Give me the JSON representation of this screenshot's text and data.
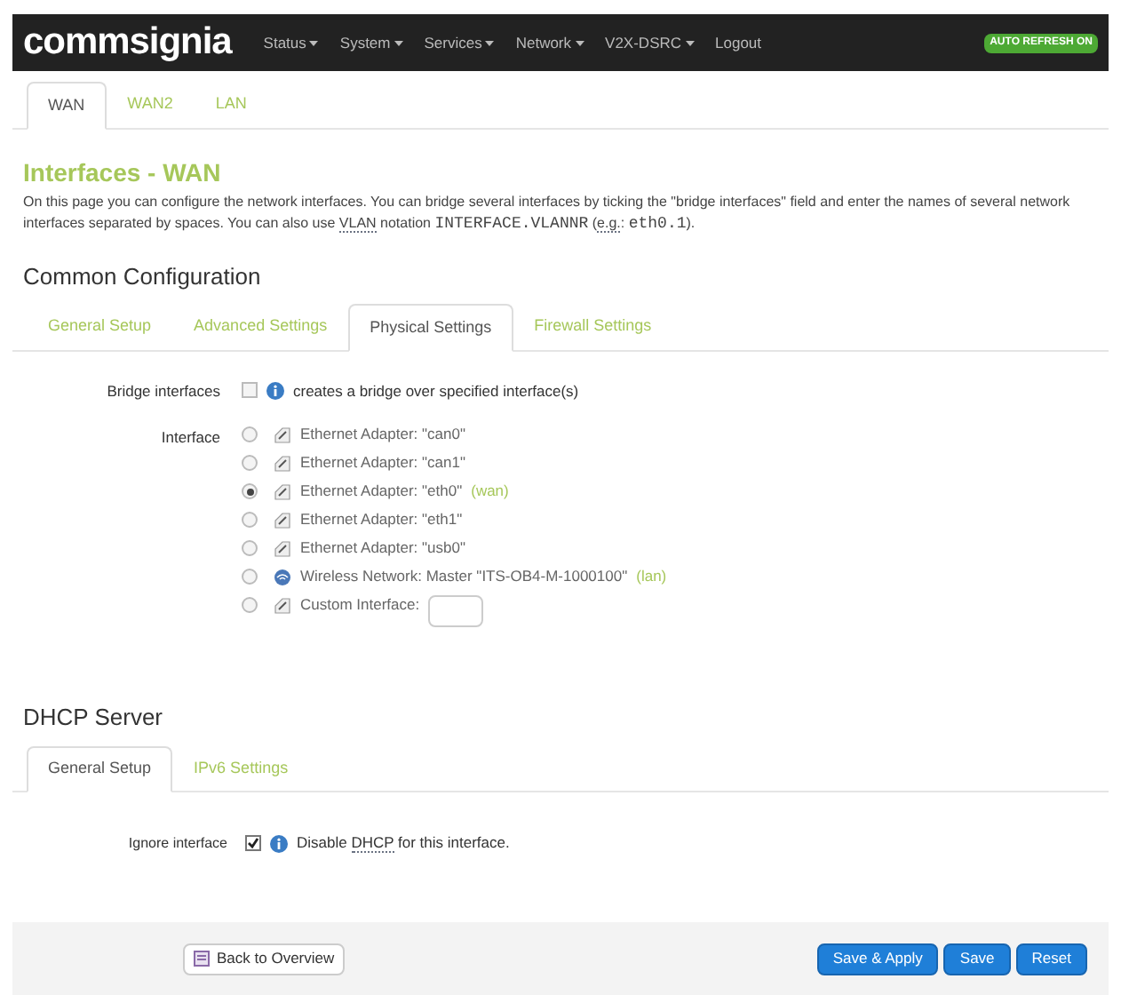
{
  "navbar": {
    "logo": "commsignia",
    "menu": [
      {
        "label": "Status",
        "dropdown": true
      },
      {
        "label": "System",
        "dropdown": true
      },
      {
        "label": "Services",
        "dropdown": true
      },
      {
        "label": "Network",
        "dropdown": true
      },
      {
        "label": "V2X-DSRC",
        "dropdown": true
      },
      {
        "label": "Logout",
        "dropdown": false
      }
    ],
    "badge": "AUTO REFRESH ON"
  },
  "tabs": [
    {
      "label": "WAN",
      "selected": true
    },
    {
      "label": "WAN2",
      "selected": false
    },
    {
      "label": "LAN",
      "selected": false
    }
  ],
  "page": {
    "title": "Interfaces - WAN",
    "description": [
      {
        "kind": "text",
        "text": "On this page you can configure the network interfaces. You can bridge several interfaces by ticking the \"bridge interfaces\" field and enter the names of several network interfaces separated by spaces. You can also use "
      },
      {
        "kind": "abbr",
        "text": "VLAN"
      },
      {
        "kind": "text",
        "text": " notation "
      },
      {
        "kind": "code",
        "text": "INTERFACE.VLANNR"
      },
      {
        "kind": "text",
        "text": " ("
      },
      {
        "kind": "abbr",
        "text": "e.g."
      },
      {
        "kind": "text",
        "text": ": "
      },
      {
        "kind": "code",
        "text": "eth0.1"
      },
      {
        "kind": "text",
        "text": ")."
      }
    ]
  },
  "common": {
    "title": "Common Configuration",
    "tabs": [
      {
        "label": "General Setup",
        "selected": false
      },
      {
        "label": "Advanced Settings",
        "selected": false
      },
      {
        "label": "Physical Settings",
        "selected": true
      },
      {
        "label": "Firewall Settings",
        "selected": false
      }
    ],
    "bridge": {
      "label": "Bridge interfaces",
      "checked": false,
      "hint": "creates a bridge over specified interface(s)"
    },
    "interface": {
      "label": "Interface",
      "options": [
        {
          "kind": "ethernet",
          "text": "Ethernet Adapter: \"can0\"",
          "selected": false
        },
        {
          "kind": "ethernet",
          "text": "Ethernet Adapter: \"can1\"",
          "selected": false
        },
        {
          "kind": "ethernet",
          "text": "Ethernet Adapter: \"eth0\"",
          "tag": "(wan)",
          "selected": true
        },
        {
          "kind": "ethernet",
          "text": "Ethernet Adapter: \"eth1\"",
          "selected": false
        },
        {
          "kind": "ethernet",
          "text": "Ethernet Adapter: \"usb0\"",
          "selected": false
        },
        {
          "kind": "wireless",
          "text": "Wireless Network: Master \"ITS-OB4-M-1000100\"",
          "tag": "(lan)",
          "selected": false
        },
        {
          "kind": "custom",
          "text": "Custom Interface:",
          "selected": false
        }
      ]
    }
  },
  "dhcp": {
    "title": "DHCP Server",
    "tabs": [
      {
        "label": "General Setup",
        "selected": true
      },
      {
        "label": "IPv6 Settings",
        "selected": false
      }
    ],
    "ignore": {
      "label": "Ignore interface",
      "checked": true,
      "hint": [
        {
          "kind": "text",
          "text": "Disable "
        },
        {
          "kind": "abbr",
          "text": "DHCP"
        },
        {
          "kind": "text",
          "text": " for this interface."
        }
      ]
    }
  },
  "footer": {
    "back": "Back to Overview",
    "buttons": [
      "Save & Apply",
      "Save",
      "Reset"
    ]
  }
}
